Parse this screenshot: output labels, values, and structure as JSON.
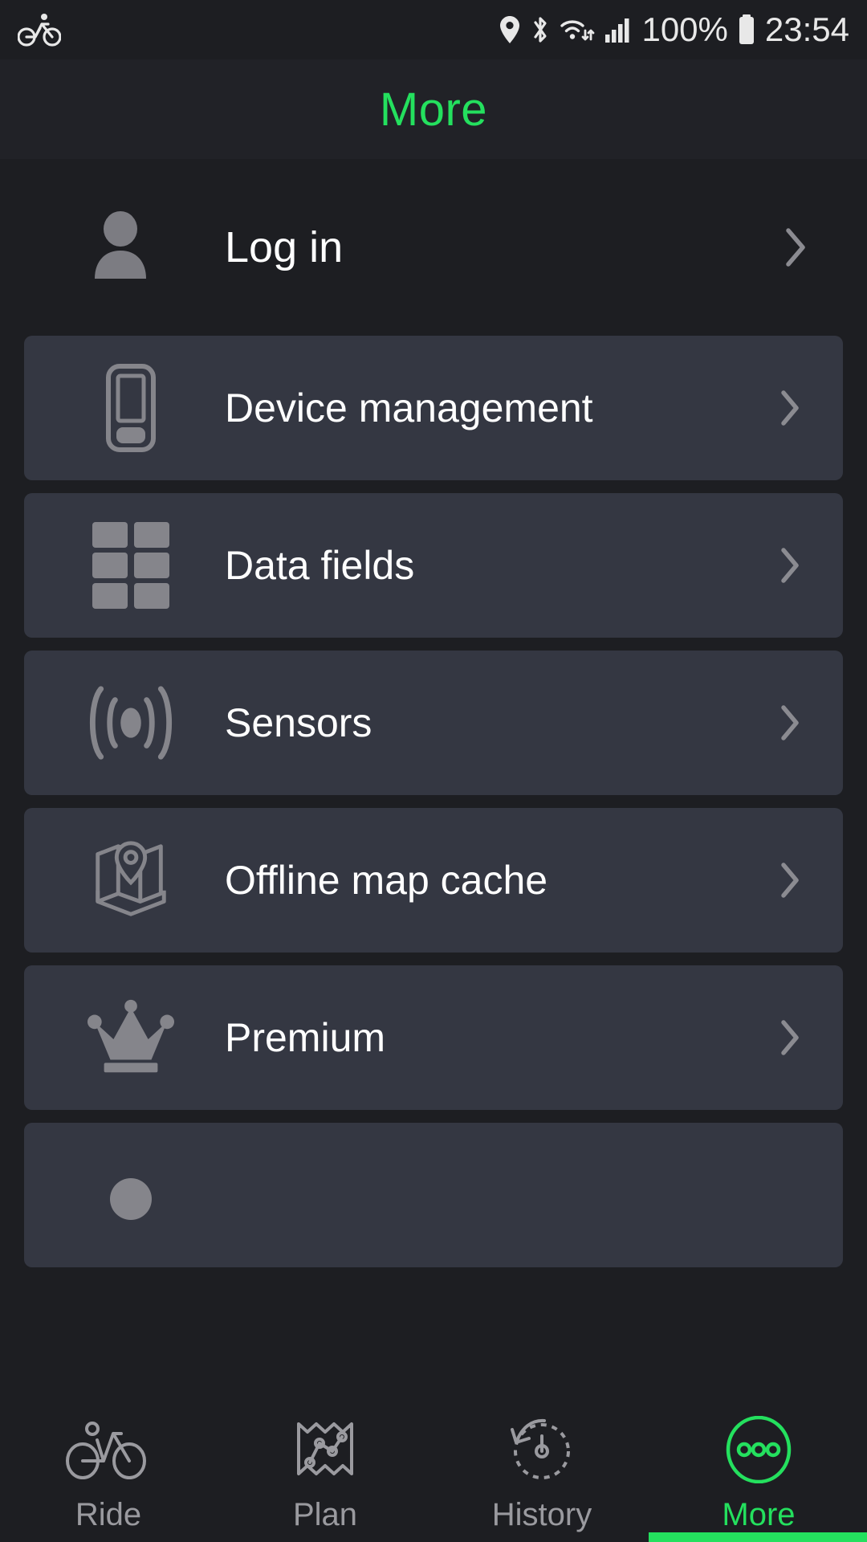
{
  "statusbar": {
    "left_icon": "bicycle-icon",
    "icons": [
      "location-pin-icon",
      "bluetooth-icon",
      "wifi-icon",
      "cellular-signal-icon"
    ],
    "battery_percent": "100%",
    "battery_icon": "battery-full-icon",
    "time": "23:54"
  },
  "header": {
    "title": "More",
    "accent_color": "#24e05e"
  },
  "account": {
    "label": "Log in",
    "icon": "person-icon",
    "chevron": "chevron-right-icon"
  },
  "menu": {
    "items": [
      {
        "label": "Device management",
        "icon": "phone-device-icon"
      },
      {
        "label": "Data fields",
        "icon": "grid-icon"
      },
      {
        "label": "Sensors",
        "icon": "broadcast-waves-icon"
      },
      {
        "label": "Offline map cache",
        "icon": "map-pin-box-icon"
      },
      {
        "label": "Premium",
        "icon": "crown-icon"
      }
    ]
  },
  "nav": {
    "items": [
      {
        "label": "Ride",
        "icon": "bicycle-icon",
        "active": false
      },
      {
        "label": "Plan",
        "icon": "route-map-icon",
        "active": false
      },
      {
        "label": "History",
        "icon": "history-clock-icon",
        "active": false
      },
      {
        "label": "More",
        "icon": "more-dots-circle-icon",
        "active": true
      }
    ]
  },
  "colors": {
    "background": "#1d1e22",
    "card": "#343742",
    "accent": "#24e05e",
    "icon_gray": "#85858b",
    "text": "#ffffff"
  }
}
